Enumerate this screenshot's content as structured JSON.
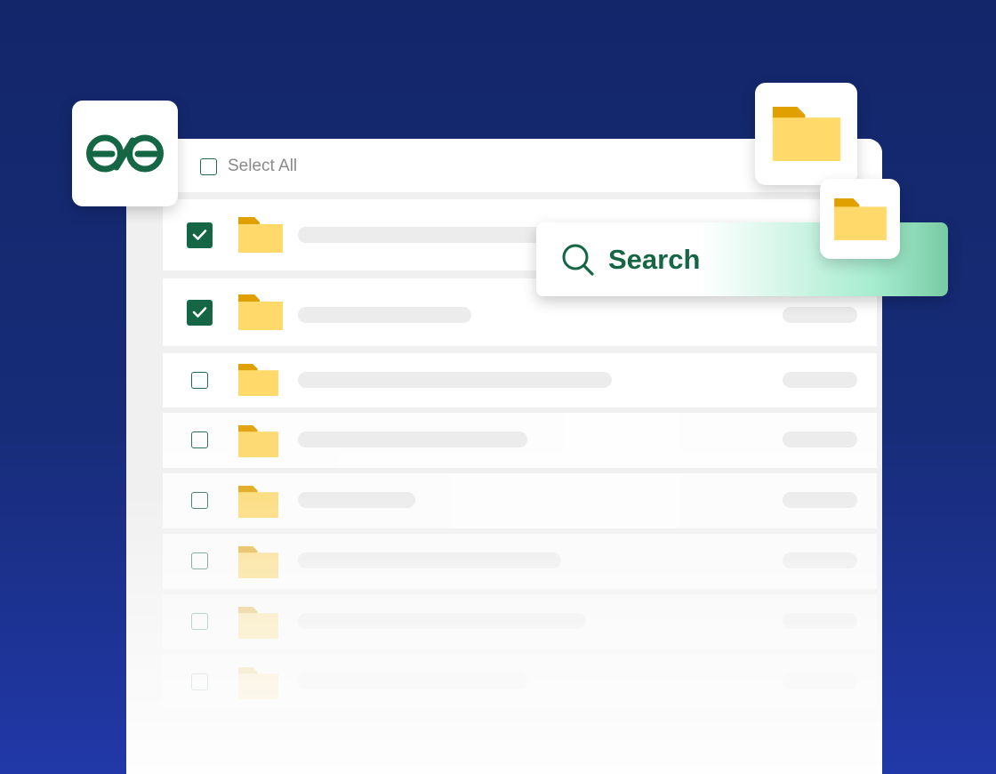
{
  "header": {
    "select_all_label": "Select All"
  },
  "search": {
    "label": "Search"
  },
  "rows": [
    {
      "checked": true
    },
    {
      "checked": true
    },
    {
      "checked": false
    },
    {
      "checked": false
    },
    {
      "checked": false
    },
    {
      "checked": false
    },
    {
      "checked": false
    },
    {
      "checked": false
    }
  ],
  "icons": {
    "logo": "infinity-logo-icon",
    "folder": "folder-icon",
    "search": "search-icon",
    "checkbox": "checkbox-icon",
    "check": "check-icon"
  },
  "colors": {
    "background_top": "#13266a",
    "background_bottom": "#2138a8",
    "brand_green": "#146644",
    "folder_body": "#ffd96a",
    "folder_tab": "#e0a000",
    "search_gradient_end": "#78cba3"
  }
}
